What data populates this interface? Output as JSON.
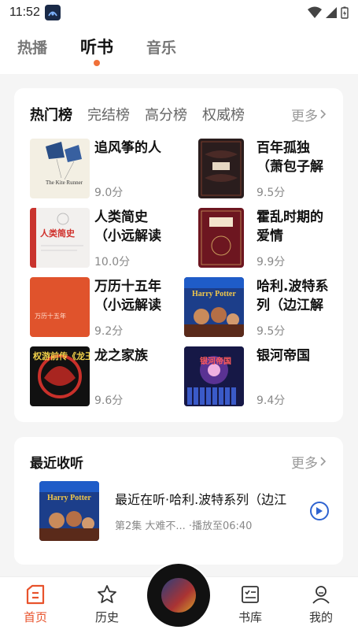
{
  "status": {
    "time": "11:52"
  },
  "top_tabs": [
    {
      "label": "热播"
    },
    {
      "label": "听书"
    },
    {
      "label": "音乐"
    }
  ],
  "rank": {
    "tabs": [
      "热门榜",
      "完结榜",
      "高分榜",
      "权威榜"
    ],
    "more": "更多",
    "books": [
      {
        "title": "追风筝的人",
        "score": "9.0分",
        "cover_text": "The Kite Runner"
      },
      {
        "title": "百年孤独（萧包子解",
        "score": "9.5分",
        "cover_text": ""
      },
      {
        "title": "人类简史（小远解读",
        "score": "10.0分",
        "cover_text": "人类简史"
      },
      {
        "title": "霍乱时期的爱情",
        "score": "9.9分",
        "cover_text": ""
      },
      {
        "title": "万历十五年（小远解读",
        "score": "9.2分",
        "cover_text": "万历十五年"
      },
      {
        "title": "哈利.波特系列（边江解",
        "score": "9.5分",
        "cover_text": "Harry Potter"
      },
      {
        "title": "龙之家族",
        "score": "9.6分",
        "cover_text": "权游前传《龙王家族》（边江解读版）"
      },
      {
        "title": "银河帝国",
        "score": "9.4分",
        "cover_text": "银河帝国"
      }
    ]
  },
  "recent": {
    "title": "最近收听",
    "more": "更多",
    "item_title": "最近在听·哈利.波特系列（边江",
    "episode": "第2集 大难不...",
    "progress": "·播放至06:40",
    "cover_text": "Harry Potter"
  },
  "nav": [
    {
      "label": "首页",
      "icon": "home-icon"
    },
    {
      "label": "历史",
      "icon": "star-icon"
    },
    {
      "label": "书库",
      "icon": "library-icon"
    },
    {
      "label": "我的",
      "icon": "profile-icon"
    }
  ],
  "colors": {
    "accent": "#e8532c",
    "tab_dot": "#f07039",
    "play": "#2e63d0"
  }
}
